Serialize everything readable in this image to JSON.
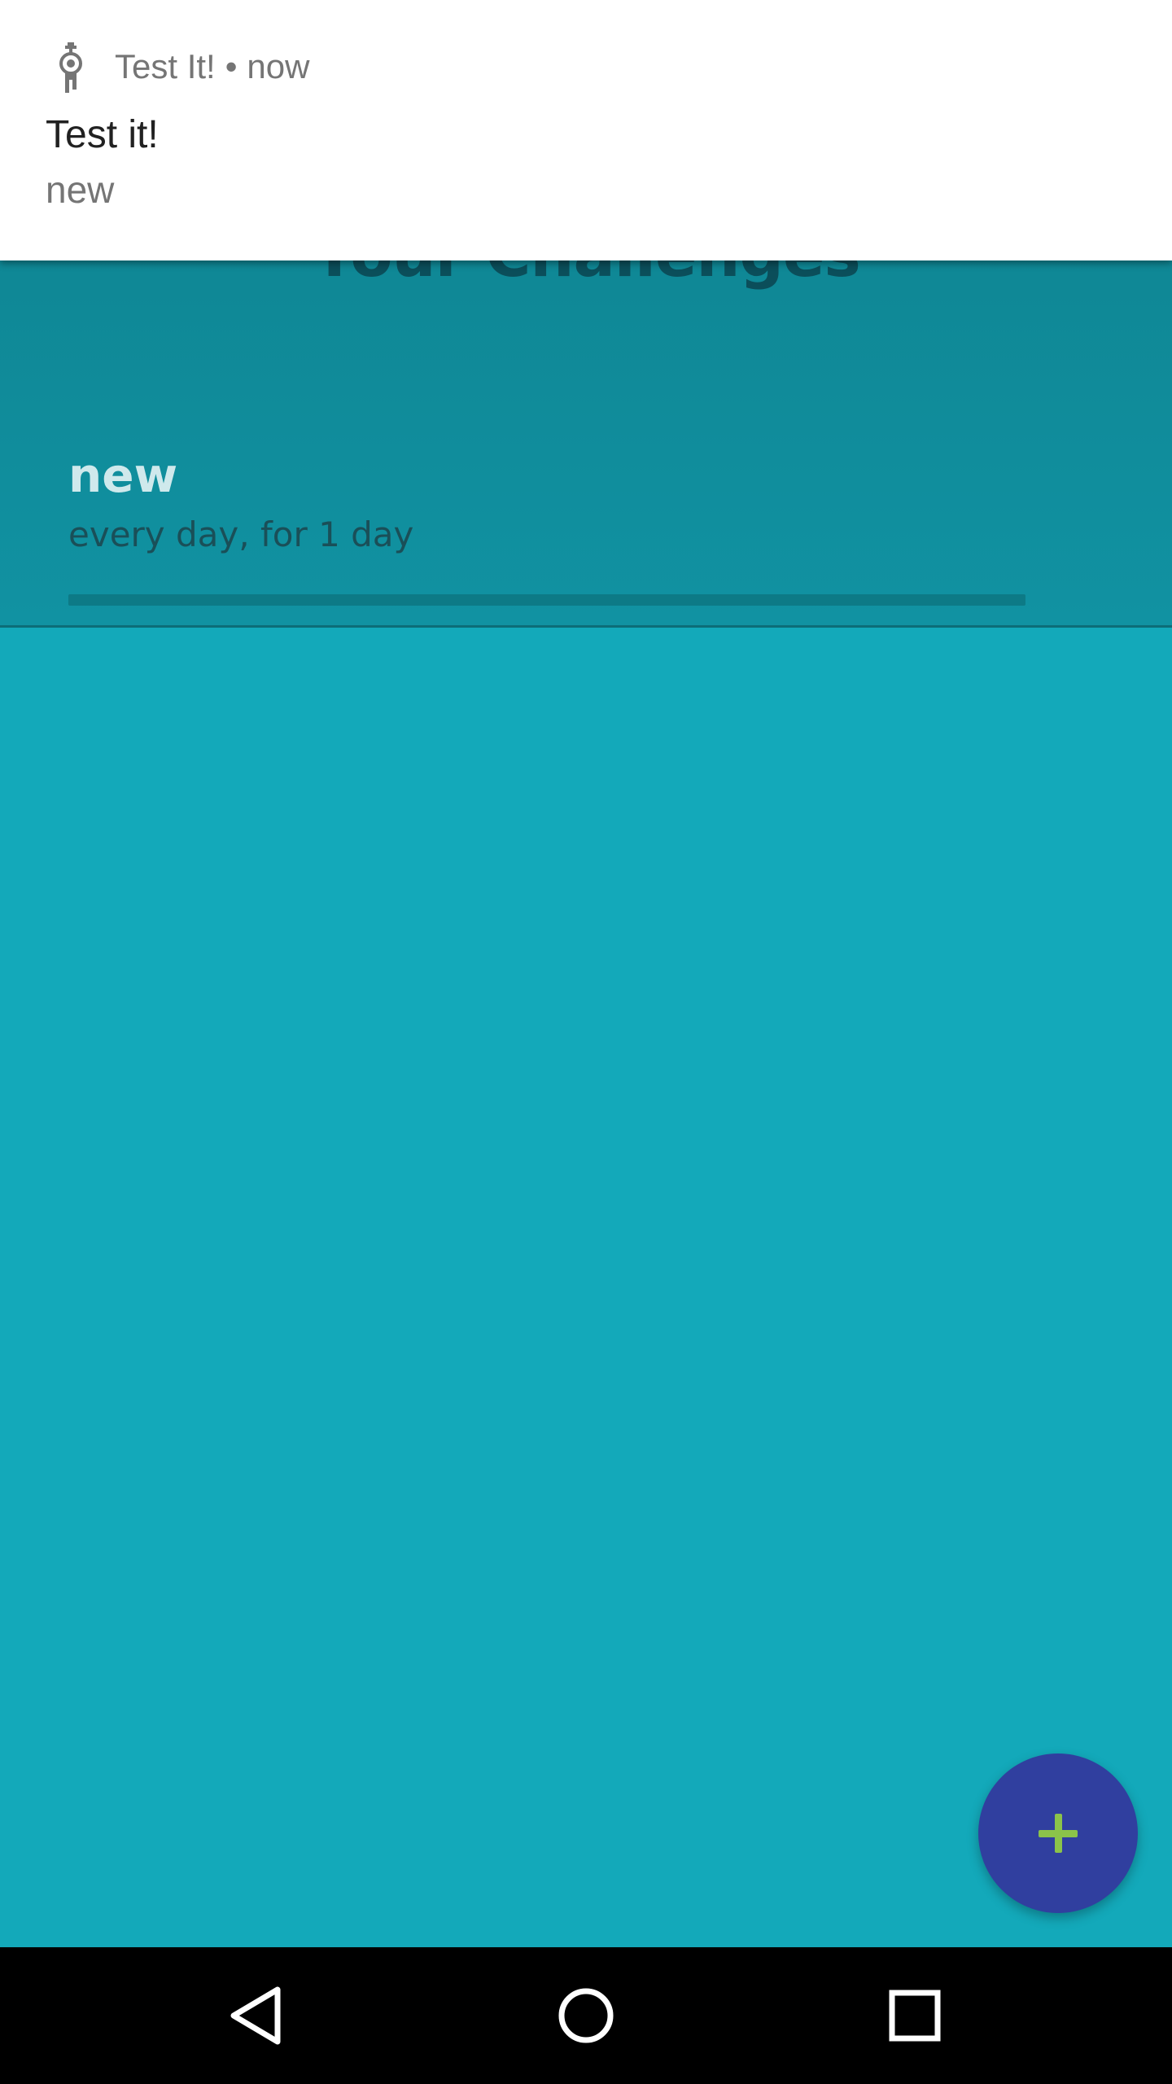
{
  "notification": {
    "app_name": "Test It!",
    "separator": "•",
    "time": "now",
    "title": "Test it!",
    "text": "new",
    "icon": "test-it-app-icon"
  },
  "screen": {
    "title": "Your Challenges"
  },
  "challenges": [
    {
      "name": "new",
      "description": "every day, for 1 day",
      "progress": 0
    }
  ],
  "fab": {
    "icon": "plus-icon",
    "color": "#303f9f",
    "icon_color": "#8bc34a"
  },
  "navbar": {
    "back_icon": "back-triangle-icon",
    "home_icon": "home-circle-icon",
    "recents_icon": "recents-square-icon"
  },
  "colors": {
    "background": "#13a9ba",
    "header": "#0f8896",
    "title_text": "#0b4e5a"
  }
}
